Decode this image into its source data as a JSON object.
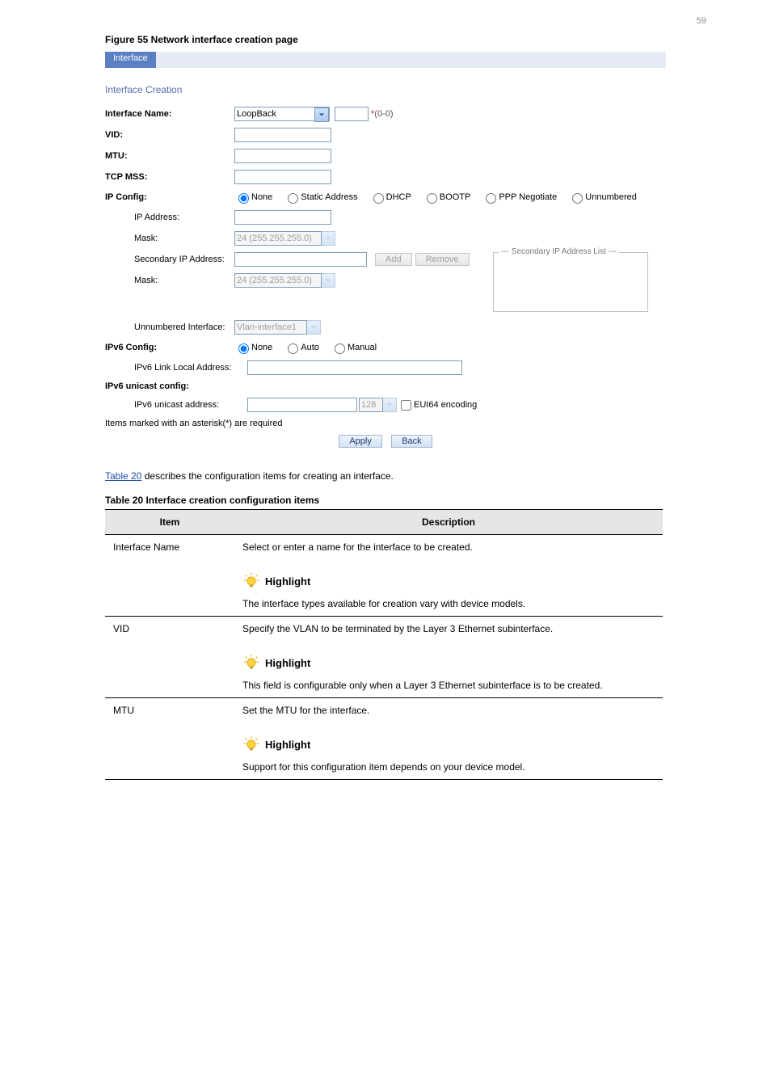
{
  "pageNumber": "59",
  "figure": {
    "caption": "Figure 55 Network interface creation page",
    "tabLabel": "Interface",
    "sectionTitle": "Interface Creation",
    "form": {
      "interfaceName": {
        "label": "Interface Name:",
        "selectValue": "LoopBack",
        "hint": "(0-0)"
      },
      "vid": {
        "label": "VID:"
      },
      "mtu": {
        "label": "MTU:"
      },
      "tcpMss": {
        "label": "TCP MSS:"
      },
      "ipConfig": {
        "label": "IP Config:",
        "options": [
          "None",
          "Static Address",
          "DHCP",
          "BOOTP",
          "PPP Negotiate",
          "Unnumbered"
        ],
        "selected": "None"
      },
      "ipAddress": {
        "label": "IP Address:"
      },
      "mask": {
        "label": "Mask:",
        "value": "24 (255.255.255.0)"
      },
      "secondaryIp": {
        "label": "Secondary IP Address:",
        "addBtn": "Add",
        "removeBtn": "Remove"
      },
      "mask2": {
        "label": "Mask:",
        "value": "24 (255.255.255.0)"
      },
      "secondaryListTitle": "--- Secondary IP Address List ---",
      "unnumbered": {
        "label": "Unnumbered Interface:",
        "value": "Vlan-interface1"
      },
      "ipv6Config": {
        "label": "IPv6 Config:",
        "options": [
          "None",
          "Auto",
          "Manual"
        ],
        "selected": "None"
      },
      "ipv6LinkLocal": {
        "label": "IPv6 Link Local Address:"
      },
      "ipv6UnicastConfig": {
        "label": "IPv6 unicast config:"
      },
      "ipv6Unicast": {
        "label": "IPv6 unicast address:",
        "prefix": "128",
        "euiLabel": "EUI64 encoding"
      },
      "note": "Items marked with an asterisk(*) are required",
      "applyBtn": "Apply",
      "backBtn": "Back"
    }
  },
  "afterFigureText": "Table 20 describes the configuration items for creating an interface.",
  "tableLink": "Table 20",
  "table": {
    "caption": "Table 20 Interface creation configuration items",
    "header": [
      "Item",
      "Description"
    ],
    "rows": [
      {
        "item": "Interface Name",
        "desc": "Select or enter a name for the interface to be created.",
        "highlight": "Highlight",
        "extra": "The interface types available for creation vary with device models."
      },
      {
        "item": "VID",
        "desc": "Specify the VLAN to be terminated by the Layer 3 Ethernet subinterface.",
        "highlight": "Highlight",
        "extra": "This field is configurable only when a Layer 3 Ethernet subinterface is to be created."
      },
      {
        "item": "MTU",
        "desc": "Set the MTU for the interface.",
        "highlight": "Highlight",
        "extra": "Support for this configuration item depends on your device model."
      }
    ]
  }
}
